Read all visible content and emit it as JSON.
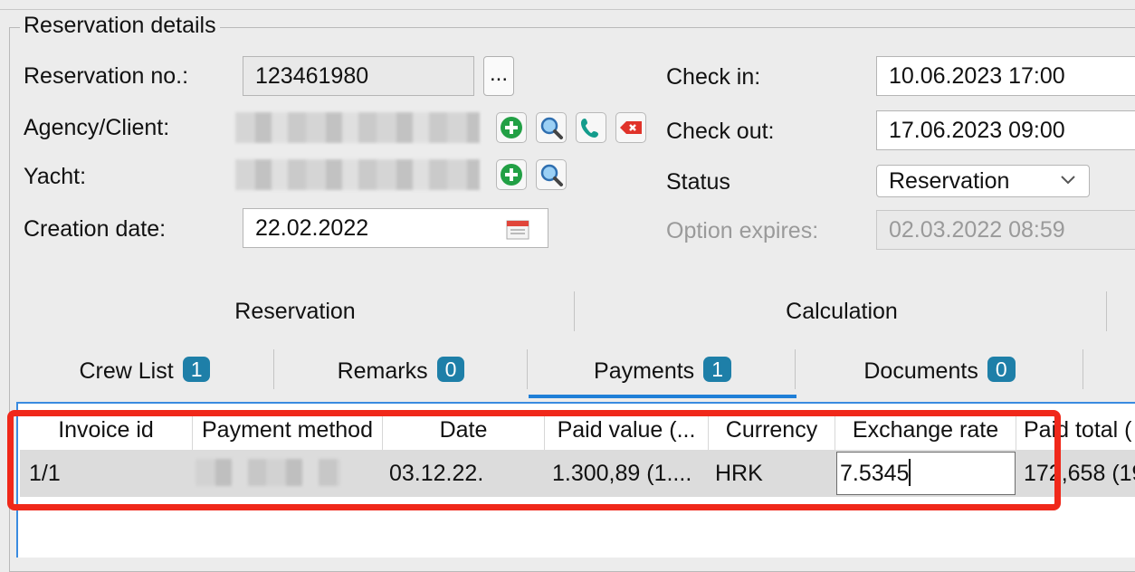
{
  "section_title": "Reservation details",
  "form": {
    "reservation_no_label": "Reservation no.:",
    "reservation_no_value": "123461980",
    "more_button": "...",
    "agency_label": "Agency/Client:",
    "yacht_label": "Yacht:",
    "creation_date_label": "Creation date:",
    "creation_date_value": "22.02.2022",
    "check_in_label": "Check in:",
    "check_in_value": "10.06.2023 17:00",
    "check_out_label": "Check out:",
    "check_out_value": "17.06.2023 09:00",
    "status_label": "Status",
    "status_value": "Reservation",
    "option_expires_label": "Option expires:",
    "option_expires_value": "02.03.2022 08:59"
  },
  "main_tabs": [
    {
      "label": "Reservation"
    },
    {
      "label": "Calculation"
    }
  ],
  "sub_tabs": [
    {
      "label": "Crew List",
      "count": "1"
    },
    {
      "label": "Remarks",
      "count": "0"
    },
    {
      "label": "Payments",
      "count": "1"
    },
    {
      "label": "Documents",
      "count": "0"
    }
  ],
  "payments_table": {
    "columns": [
      "Invoice id",
      "Payment method",
      "Date",
      "Paid value (...",
      "Currency",
      "Exchange rate",
      "Paid total ("
    ],
    "rows": [
      {
        "invoice_id": "1/1",
        "date": "03.12.22.",
        "paid_value": "1.300,89 (1....",
        "currency": "HRK",
        "exchange_rate": "7.5345",
        "paid_total": "172,658 (19"
      }
    ]
  },
  "colors": {
    "accent": "#1f7fd7",
    "badge": "#1e7fa8",
    "highlight": "#f0281a"
  },
  "icons": [
    "add-icon",
    "search-icon",
    "phone-icon",
    "remove-tag-icon",
    "calendar-icon",
    "chevron-down-icon"
  ]
}
